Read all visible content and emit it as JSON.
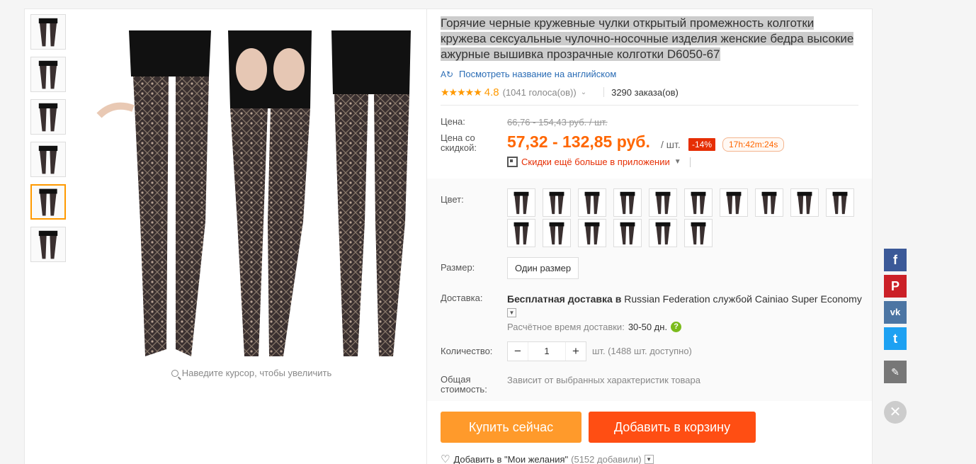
{
  "product": {
    "title": "Горячие черные кружевные чулки открытый промежность колготки кружева сексуальные чулочно-носочные изделия женские бедра высокие ажурные вышивка прозрачные колготки D6050-67",
    "translate_link": "Посмотреть название на английском",
    "rating": "4.8",
    "stars": "★★★★★",
    "votes": "(1041 голоса(ов))",
    "orders": "3290 заказа(ов)"
  },
  "gallery": {
    "zoom_hint": "Наведите курсор, чтобы увеличить",
    "thumb_count": 6,
    "active_thumb": 5
  },
  "price": {
    "label": "Цена:",
    "old": "66,76 - 154,43 руб. / шт.",
    "discount_label": "Цена со скидкой:",
    "new": "57,32 - 132,85 руб.",
    "per_unit": "/ шт.",
    "discount_badge": "-14%",
    "timer": "17h:42m:24s",
    "app_deal": "Скидки ещё больше в приложении"
  },
  "options": {
    "color_label": "Цвет:",
    "color_count": 16,
    "size_label": "Размер:",
    "size_value": "Один размер"
  },
  "shipping": {
    "label": "Доставка:",
    "free": "Бесплатная доставка в",
    "rest": " Russian Federation службой Cainiao Super Economy",
    "eta_label": "Расчётное время доставки:",
    "eta_value": "30-50 дн."
  },
  "quantity": {
    "label": "Количество:",
    "value": "1",
    "minus": "−",
    "plus": "+",
    "available": "шт. (1488 шт. доступно)"
  },
  "total": {
    "label": "Общая стоимость:",
    "value": "Зависит от выбранных характеристик товара"
  },
  "actions": {
    "buy_now": "Купить сейчас",
    "add_to_cart": "Добавить в корзину",
    "wishlist": "Добавить в \"Мои желания\"",
    "wishlist_count": "(5152 добавили)"
  },
  "social": {
    "facebook": "f",
    "pinterest": "P",
    "vk": "vk",
    "twitter": "t",
    "edit": "✎",
    "close": "✕"
  },
  "colors": {
    "accent": "#ff6600",
    "buy": "#ff9a2b",
    "cart": "#ff4e13",
    "discount": "#e62e04"
  }
}
